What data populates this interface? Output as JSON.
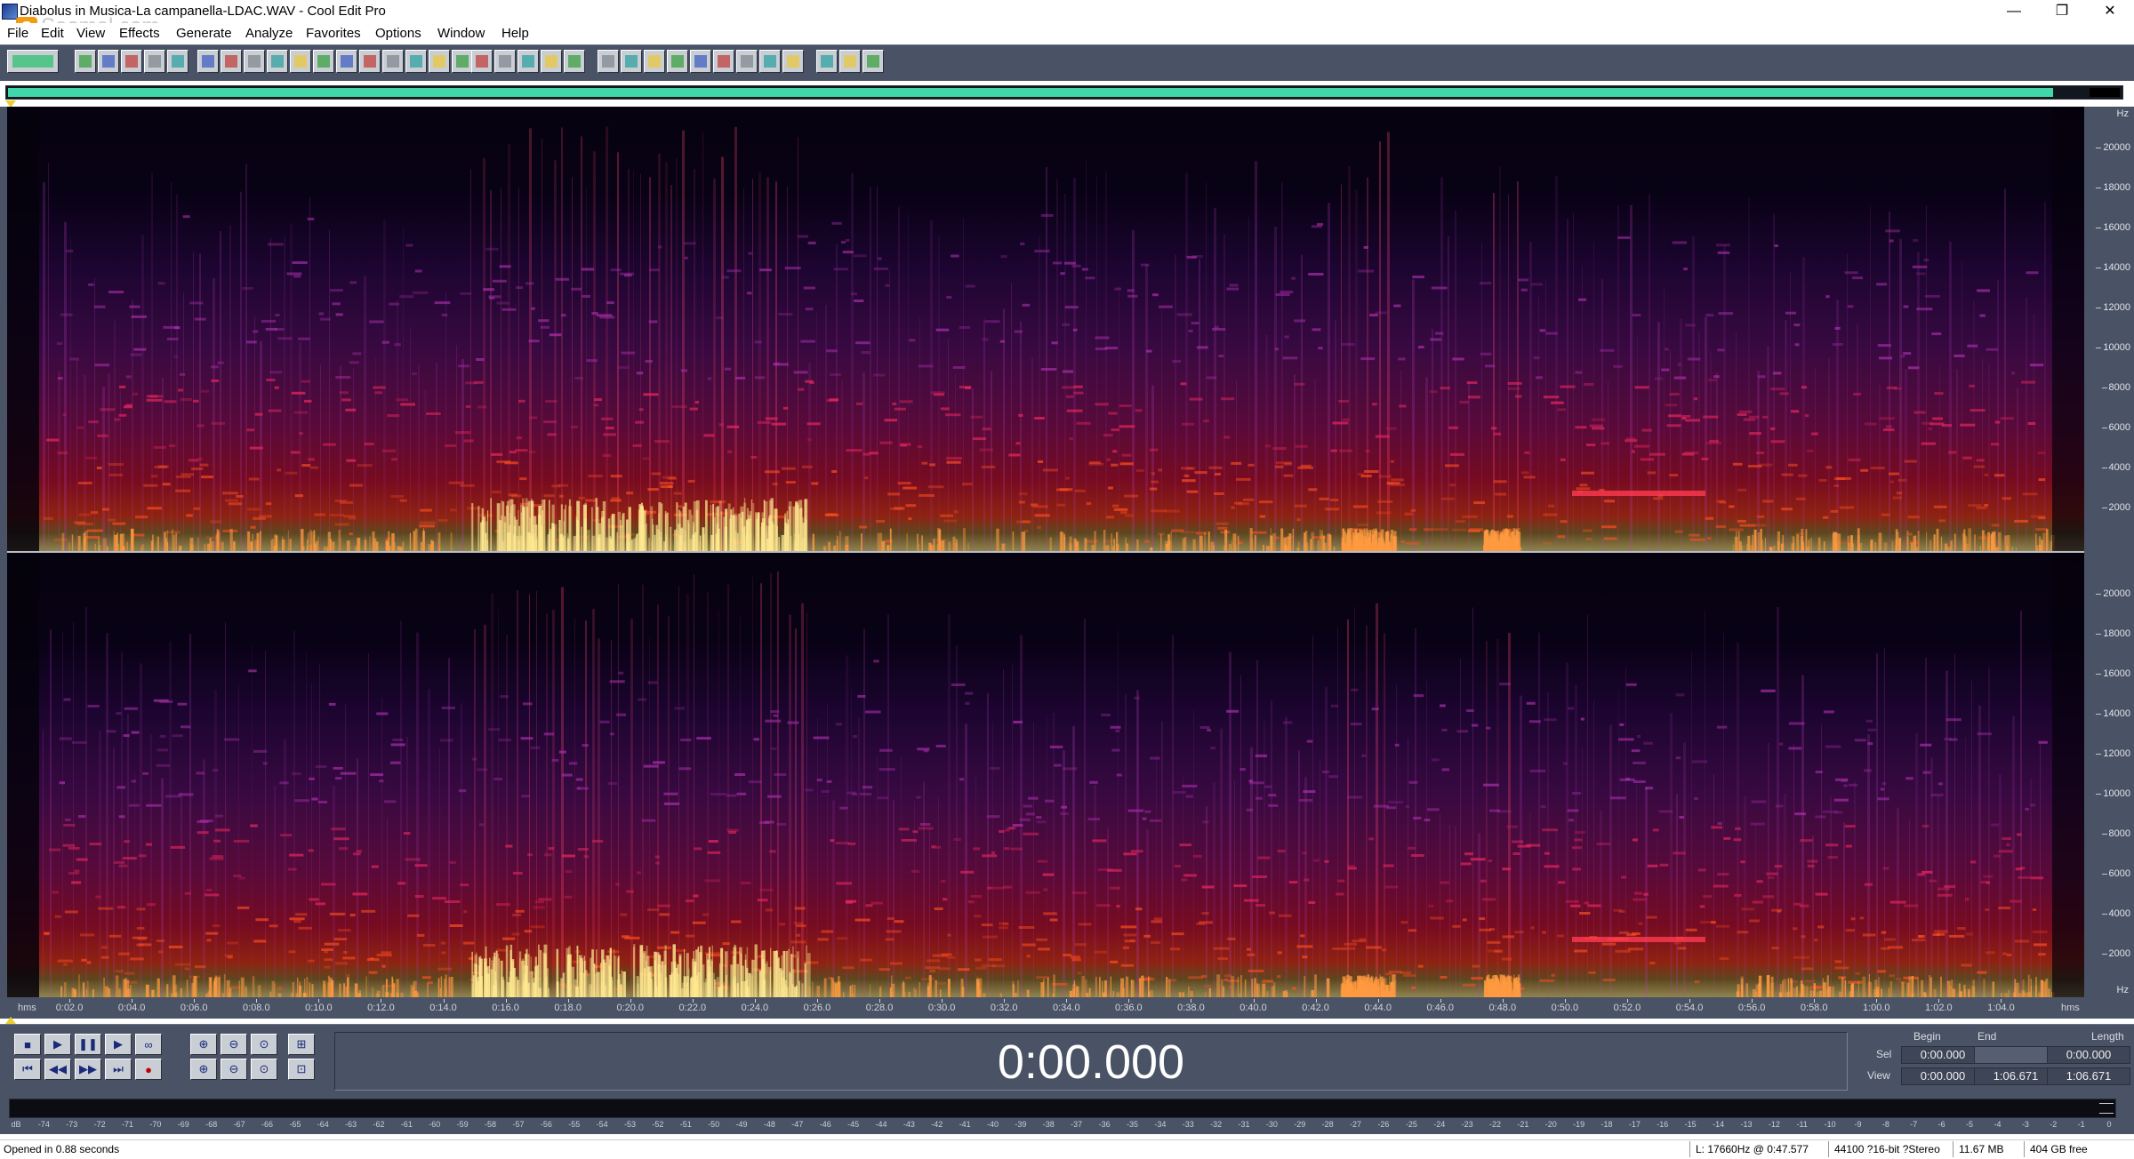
{
  "window": {
    "title": "Diabolus in Musica-La campanella-LDAC.WAV - Cool Edit Pro",
    "watermark": "Soomal.com",
    "watermark_logo_letter": "S",
    "controls": {
      "minimize": "—",
      "restore": "❐",
      "close": "✕"
    }
  },
  "menu": [
    "File",
    "Edit",
    "View",
    "Effects",
    "Generate",
    "Analyze",
    "Favorites",
    "Options",
    "Window",
    "Help"
  ],
  "toolbar": {
    "groups": [
      [
        "wave-view-icon"
      ],
      [
        "new-file-icon",
        "open-file-icon",
        "save-icon",
        "save-all-icon",
        "close-file-icon"
      ],
      [
        "undo-icon",
        "redo-icon",
        "repeat-icon",
        "copy-new-icon",
        "copy-icon",
        "cut-icon",
        "paste-icon",
        "paste-new-icon",
        "mix-paste-icon",
        "trim-icon",
        "select-all-icon",
        "delete-icon"
      ],
      [
        "envelope-icon",
        "normalize-icon",
        "filter-icon",
        "noise-icon",
        "analysis-icon"
      ],
      [
        "markers-icon",
        "cue-list-icon",
        "play-list-icon",
        "spectral-view-icon",
        "zoom-view-icon",
        "frequency-analysis-icon",
        "phase-icon",
        "statistics-icon",
        "info-icon"
      ],
      [
        "settings-icon",
        "edit-notes-icon",
        "help-icon"
      ]
    ]
  },
  "frequency_scale": {
    "unit": "Hz",
    "ticks": [
      "20000",
      "18000",
      "16000",
      "14000",
      "12000",
      "10000",
      "8000",
      "6000",
      "4000",
      "2000"
    ]
  },
  "time_ruler": {
    "start_label": "hms",
    "end_label": "hms",
    "ticks": [
      "0:02.0",
      "0:04.0",
      "0:06.0",
      "0:08.0",
      "0:10.0",
      "0:12.0",
      "0:14.0",
      "0:16.0",
      "0:18.0",
      "0:20.0",
      "0:22.0",
      "0:24.0",
      "0:26.0",
      "0:28.0",
      "0:30.0",
      "0:32.0",
      "0:34.0",
      "0:36.0",
      "0:38.0",
      "0:40.0",
      "0:42.0",
      "0:44.0",
      "0:46.0",
      "0:48.0",
      "0:50.0",
      "0:52.0",
      "0:54.0",
      "0:56.0",
      "0:58.0",
      "1:00.0",
      "1:02.0",
      "1:04.0"
    ],
    "total_seconds": 66.671
  },
  "transport": {
    "row1": [
      "■",
      "▶",
      "❚❚",
      "▶",
      "∞"
    ],
    "row2": [
      "⏮",
      "◀◀",
      "▶▶",
      "⏭",
      "●"
    ],
    "zoom_row1": [
      "⊕",
      "⊖",
      "⊙",
      "⊞"
    ],
    "zoom_row2": [
      "⊕",
      "⊖",
      "⊙",
      "⊡"
    ]
  },
  "time_display": "0:00.000",
  "selection": {
    "headers": {
      "begin": "Begin",
      "end": "End",
      "length": "Length"
    },
    "sel": {
      "label": "Sel",
      "begin": "0:00.000",
      "end": "",
      "length": "0:00.000"
    },
    "view": {
      "label": "View",
      "begin": "0:00.000",
      "end": "1:06.671",
      "length": "1:06.671"
    }
  },
  "level_meter": {
    "ticks": [
      "dB",
      "-74",
      "-73",
      "-72",
      "-71",
      "-70",
      "-69",
      "-68",
      "-67",
      "-66",
      "-65",
      "-64",
      "-63",
      "-62",
      "-61",
      "-60",
      "-59",
      "-58",
      "-57",
      "-56",
      "-55",
      "-54",
      "-53",
      "-52",
      "-51",
      "-50",
      "-49",
      "-48",
      "-47",
      "-46",
      "-45",
      "-44",
      "-43",
      "-42",
      "-41",
      "-40",
      "-39",
      "-38",
      "-37",
      "-36",
      "-35",
      "-34",
      "-33",
      "-32",
      "-31",
      "-30",
      "-29",
      "-28",
      "-27",
      "-26",
      "-25",
      "-24",
      "-23",
      "-22",
      "-21",
      "-20",
      "-19",
      "-18",
      "-17",
      "-16",
      "-15",
      "-14",
      "-13",
      "-12",
      "-11",
      "-10",
      "-9",
      "-8",
      "-7",
      "-6",
      "-5",
      "-4",
      "-3",
      "-2",
      "-1",
      "0"
    ]
  },
  "status": {
    "message": "Opened in 0.88 seconds",
    "cursor": "L: 17660Hz @   0:47.577",
    "format": "44100 ?16-bit ?Stereo",
    "file_size": "11.67 MB",
    "disk_free": "404 GB free"
  },
  "colors": {
    "panel": "#4a5366",
    "position_bar": "#40d8a8",
    "cursor_marker": "#e8d030"
  }
}
